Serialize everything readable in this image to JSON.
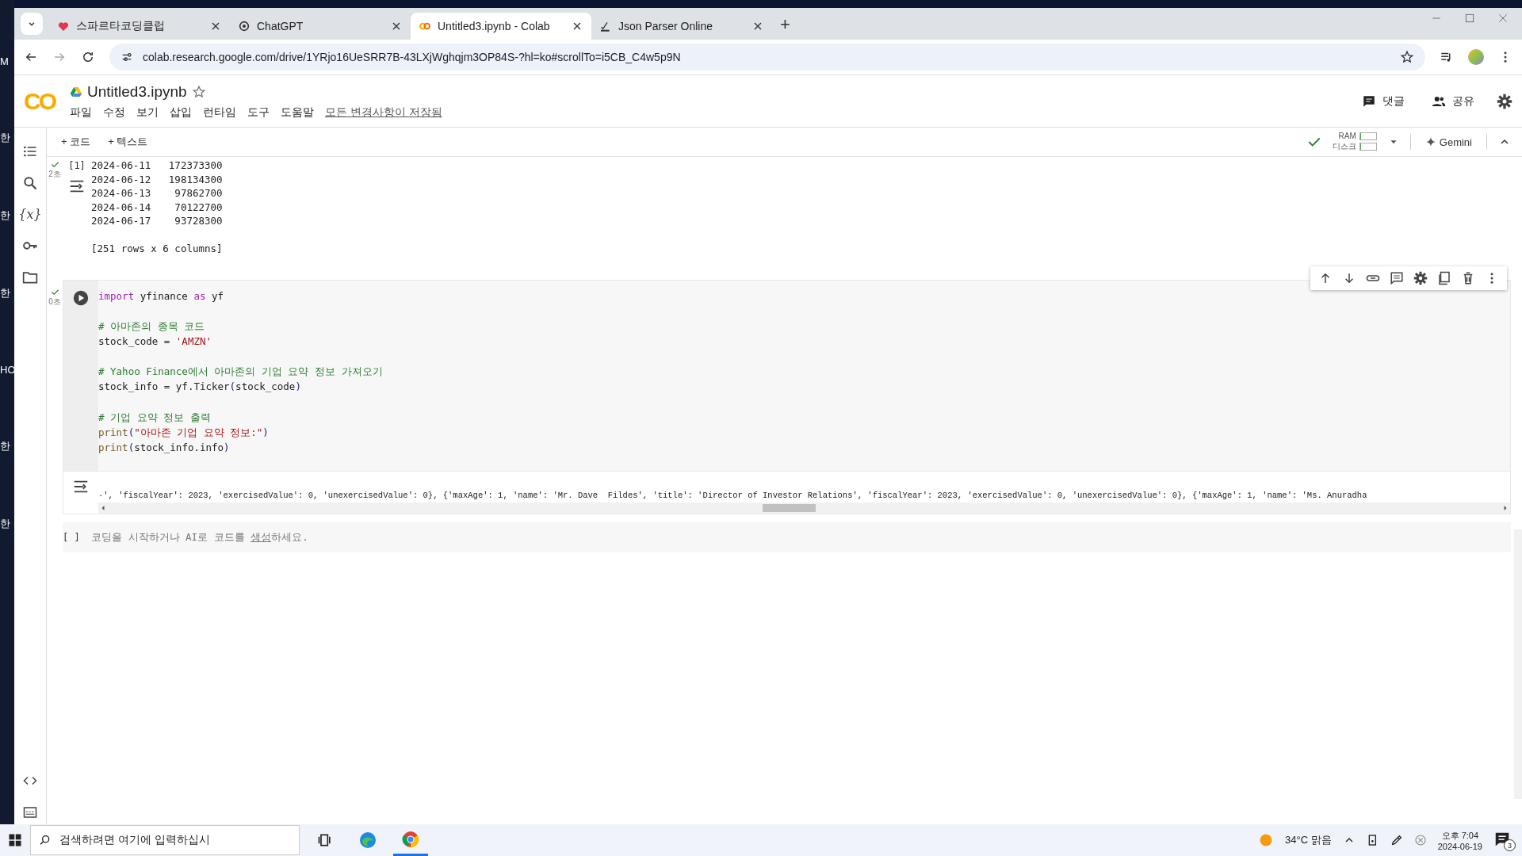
{
  "desktop": {
    "labels": [
      "M",
      "한",
      "한",
      "한",
      "HO",
      "한",
      "한"
    ]
  },
  "browser": {
    "tabs": [
      {
        "title": "스파르타코딩클럽",
        "selected": false
      },
      {
        "title": "ChatGPT",
        "selected": false
      },
      {
        "title": "Untitled3.ipynb - Colab",
        "selected": true
      },
      {
        "title": "Json Parser Online",
        "selected": false
      }
    ],
    "new_tab": "+",
    "url": "colab.research.google.com/drive/1YRjo16UeSRR7B-43LXjWghqjm3OP84S-?hl=ko#scrollTo=i5CB_C4w5p9N"
  },
  "colab": {
    "logo": "CO",
    "title": "Untitled3.ipynb",
    "menu": [
      "파일",
      "수정",
      "보기",
      "삽입",
      "런타임",
      "도구",
      "도움말"
    ],
    "save_status": "모든 변경사항이 저장됨",
    "header_buttons": [
      {
        "label": "댓글"
      },
      {
        "label": "공유"
      }
    ],
    "sidebar": {
      "variables": "{x}"
    },
    "toolbar": {
      "add": [
        "+ 코드",
        "+ 텍스트"
      ],
      "resources": [
        {
          "label": "RAM",
          "level": 0.04
        },
        {
          "label": "디스크",
          "level": 0.06
        }
      ],
      "gemini": "Gemini"
    }
  },
  "cells": [
    {
      "kind": "output",
      "count": "[1]",
      "time": "2초",
      "lines": [
        "2024-06-11   172373300",
        "2024-06-12   198134300",
        "2024-06-13    97862700",
        "2024-06-14    70122700",
        "2024-06-17    93728300"
      ],
      "summary": "[251 rows x 6 columns]"
    },
    {
      "kind": "code",
      "time": "0초",
      "blocks": [
        [
          [
            {
              "kind": "keyword",
              "text": "import"
            },
            {
              "kind": "plain",
              "text": " yfinance "
            },
            {
              "kind": "keyword",
              "text": "as"
            },
            {
              "kind": "plain",
              "text": " yf"
            }
          ]
        ],
        [
          [
            {
              "kind": "comment",
              "text": "# 아마존의 종목 코드"
            }
          ],
          [
            {
              "kind": "plain",
              "text": "stock_code = "
            },
            {
              "kind": "string",
              "text": "'AMZN'"
            }
          ]
        ],
        [
          [
            {
              "kind": "comment",
              "text": "# Yahoo Finance에서 아마존의 기업 요약 정보 가져오기"
            }
          ],
          [
            {
              "kind": "plain",
              "text": "stock_info = yf.Ticker"
            },
            {
              "kind": "paren",
              "text": "("
            },
            {
              "kind": "plain",
              "text": "stock_code"
            },
            {
              "kind": "paren",
              "text": ")"
            }
          ]
        ],
        [
          [
            {
              "kind": "comment",
              "text": "# 기업 요약 정보 출력"
            }
          ],
          [
            {
              "kind": "builtin",
              "text": "print"
            },
            {
              "kind": "paren",
              "text": "("
            },
            {
              "kind": "string",
              "text": "\"아마존 기업 요약 정보:\""
            },
            {
              "kind": "paren",
              "text": ")"
            }
          ],
          [
            {
              "kind": "builtin",
              "text": "print"
            },
            {
              "kind": "paren",
              "text": "("
            },
            {
              "kind": "plain",
              "text": "stock_info.info"
            },
            {
              "kind": "paren",
              "text": ")"
            }
          ]
        ]
      ],
      "output": "·', 'fiscalYear': 2023, 'exercisedValue': 0, 'unexercisedValue': 0}, {'maxAge': 1, 'name': 'Mr. Dave  Fildes', 'title': 'Director of Investor Relations', 'fiscalYear': 2023, 'exercisedValue': 0, 'unexercisedValue': 0}, {'maxAge': 1, 'name': 'Ms. Anuradha"
    },
    {
      "kind": "empty",
      "count": "[ ]",
      "hint_before": "코딩을 시작하거나 AI로 코드를 ",
      "hint_link": "생성",
      "hint_after": "하세요."
    }
  ],
  "taskbar": {
    "search_placeholder": "검색하려면 여기에 입력하십시",
    "weather": "34°C  맑음",
    "time": "오후 7:04",
    "date": "2024-06-19",
    "notifications": "3"
  }
}
